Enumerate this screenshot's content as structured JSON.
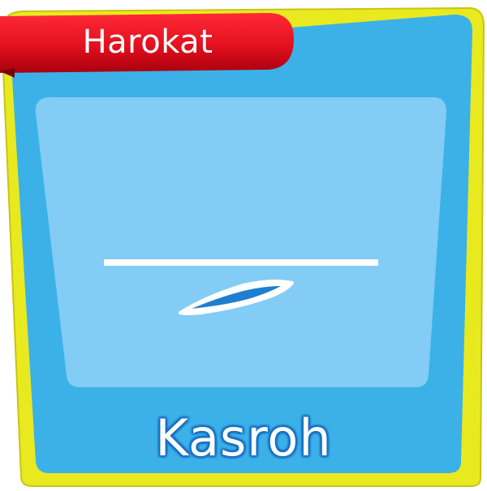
{
  "card": {
    "category": "Harokat",
    "title": "Kasroh",
    "symbol_icon": "kasroh-diacritic-icon"
  },
  "colors": {
    "outer_frame": "#e8ea1f",
    "card_body": "#3bb1e8",
    "inner_panel": "#82ccf5",
    "ribbon": "#e3101e",
    "title_outline": "#1a6fc0",
    "glyph": "#ffffff"
  }
}
